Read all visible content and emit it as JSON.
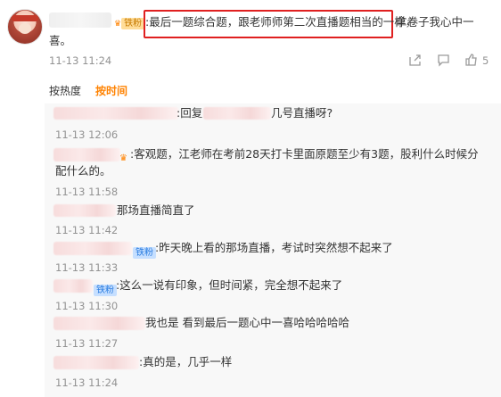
{
  "main_comment": {
    "badge_small": "铁粉",
    "text_part1": ":最后一题综合题，跟老师师第二次直播题相当的一样，",
    "text_part2": "拿卷子我心中一",
    "text_line2": "喜。",
    "time": "11-13 11:24",
    "like_count": "5"
  },
  "sort_tabs": {
    "hot": "按热度",
    "time": "按时间"
  },
  "replies": [
    {
      "text": ":回复",
      "text2": "几号直播呀?",
      "time": "11-13 12:06"
    },
    {
      "text": ":客观题，江老师在考前28天打卡里面原题至少有3题，股利什么时候分",
      "text_line2": "配什么的。",
      "time": "11-13 11:58"
    },
    {
      "text": "那场直播简直了",
      "time": "11-13 11:42"
    },
    {
      "badge": "铁粉",
      "text": ":昨天晚上看的那场直播，考试时突然想不起来了",
      "time": "11-13 11:33"
    },
    {
      "badge": "铁粉",
      "text": ":这么一说有印象，但时间紧，完全想不起来了",
      "time": "11-13 11:30"
    },
    {
      "text": "我也是 看到最后一题心中一喜哈哈哈哈哈",
      "time": "11-13 11:27"
    },
    {
      "text": ":真的是，几乎一样",
      "time": "11-13 11:24"
    }
  ]
}
